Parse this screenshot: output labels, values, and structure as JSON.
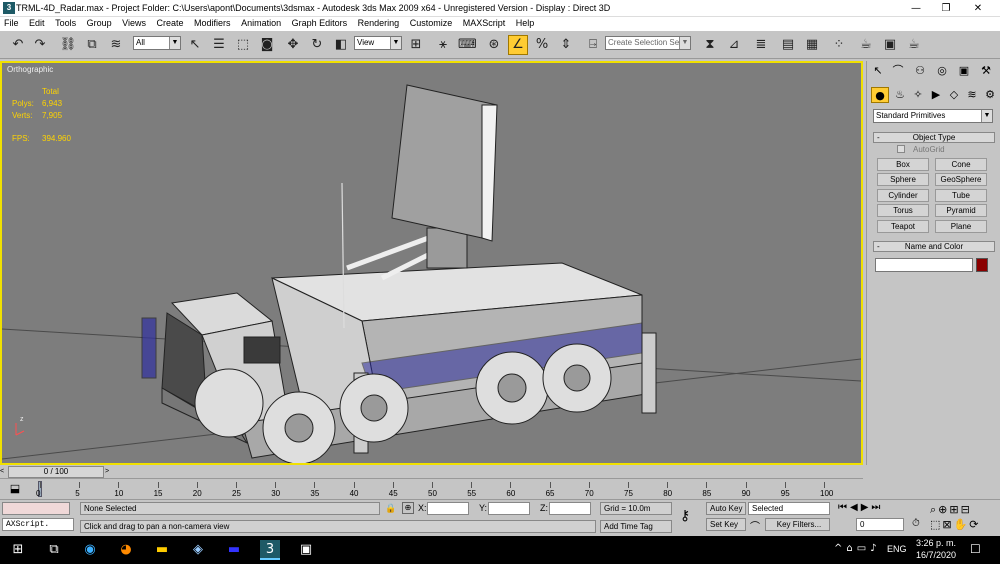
{
  "title": {
    "text": "TRML-4D_Radar.max     - Project Folder: C:\\Users\\apont\\Documents\\3dsmax     - Autodesk 3ds Max  2009 x64    - Unregistered Version     - Display : Direct 3D",
    "minimize": "—",
    "maximize": "❐",
    "close": "✕"
  },
  "menu": [
    "File",
    "Edit",
    "Tools",
    "Group",
    "Views",
    "Create",
    "Modifiers",
    "Animation",
    "Graph Editors",
    "Rendering",
    "Customize",
    "MAXScript",
    "Help"
  ],
  "toolbar": {
    "selection_filter": "All",
    "ref_coord": "View",
    "named_selection_placeholder": "Create Selection Set"
  },
  "viewport": {
    "label": "Orthographic",
    "stats": {
      "total_label": "Total",
      "polys_label": "Polys:",
      "polys_value": "6,943",
      "verts_label": "Verts:",
      "verts_value": "7,905",
      "fps_label": "FPS:",
      "fps_value": "394.960"
    },
    "axis_z": "z"
  },
  "command_panel": {
    "category": "Standard Primitives",
    "object_type_header": "Object Type",
    "autogrid": "AutoGrid",
    "buttons": [
      "Box",
      "Cone",
      "Sphere",
      "GeoSphere",
      "Cylinder",
      "Tube",
      "Torus",
      "Pyramid",
      "Teapot",
      "Plane"
    ],
    "name_color_header": "Name and Color",
    "object_color": "#8b0000"
  },
  "timeline": {
    "frame_display": "0 / 100",
    "ticks": [
      "0",
      "5",
      "10",
      "15",
      "20",
      "25",
      "30",
      "35",
      "40",
      "45",
      "50",
      "55",
      "60",
      "65",
      "70",
      "75",
      "80",
      "85",
      "90",
      "95",
      "100"
    ]
  },
  "status": {
    "selection": "None Selected",
    "prompt": "Click and drag to pan a non-camera view",
    "maxscript": "AXScript.",
    "x_label": "X:",
    "y_label": "Y:",
    "z_label": "Z:",
    "grid": "Grid = 10.0m",
    "add_time_tag": "Add Time Tag",
    "auto_key": "Auto Key",
    "set_key": "Set Key",
    "key_mode": "Selected",
    "key_filters": "Key Filters...",
    "current_frame": "0"
  },
  "taskbar": {
    "lang": "ENG",
    "time": "3:26 p. m.",
    "date": "16/7/2020"
  }
}
